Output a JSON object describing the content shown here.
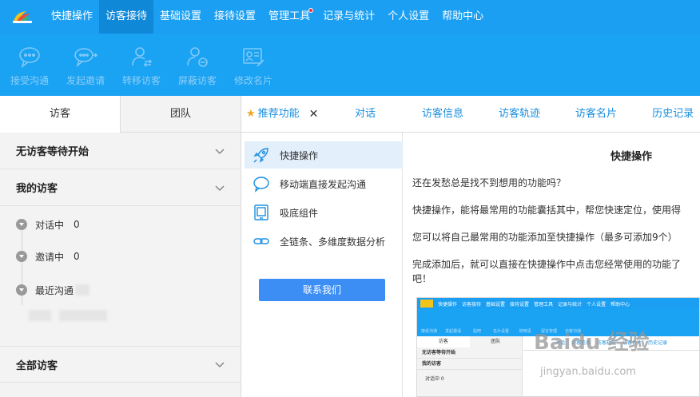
{
  "topnav": {
    "items": [
      {
        "label": "快捷操作"
      },
      {
        "label": "访客接待"
      },
      {
        "label": "基础设置"
      },
      {
        "label": "接待设置"
      },
      {
        "label": "管理工具"
      },
      {
        "label": "记录与统计"
      },
      {
        "label": "个人设置"
      },
      {
        "label": "帮助中心"
      }
    ],
    "active_index": 1,
    "notification_dot_index": 4
  },
  "toolbar": {
    "items": [
      {
        "label": "接受沟通",
        "icon": "chat-bubble-icon"
      },
      {
        "label": "发起邀请",
        "icon": "chat-send-icon"
      },
      {
        "label": "转移访客",
        "icon": "user-transfer-icon"
      },
      {
        "label": "屏蔽访客",
        "icon": "user-block-icon"
      },
      {
        "label": "修改名片",
        "icon": "card-edit-icon"
      }
    ]
  },
  "left": {
    "tabs": [
      {
        "label": "访客"
      },
      {
        "label": "团队"
      }
    ],
    "sections": {
      "waiting": "无访客等待开始",
      "my_visitors": "我的访客",
      "all_visitors": "全部访客"
    },
    "tree": [
      {
        "label": "对话中",
        "count": "0"
      },
      {
        "label": "邀请中",
        "count": "0"
      },
      {
        "label": "最近沟通",
        "count": ""
      }
    ]
  },
  "right": {
    "tabs": [
      {
        "label": "推荐功能"
      },
      {
        "label": "对话"
      },
      {
        "label": "访客信息"
      },
      {
        "label": "访客轨迹"
      },
      {
        "label": "访客名片"
      },
      {
        "label": "历史记录"
      }
    ],
    "close_glyph": "✕",
    "menu": [
      {
        "label": "快捷操作",
        "icon": "rocket-icon"
      },
      {
        "label": "移动端直接发起沟通",
        "icon": "chat-bubble-icon"
      },
      {
        "label": "吸底组件",
        "icon": "tablet-icon"
      },
      {
        "label": "全链条、多维度数据分析",
        "icon": "link-icon"
      }
    ],
    "contact_button": "联系我们",
    "content": {
      "title": "快捷操作",
      "p1": "还在发愁总是找不到想用的功能吗？",
      "p2": "快捷操作，能将最常用的功能囊括其中，帮您快速定位，使用得",
      "p3": "您可以将自己最常用的功能添加至快捷操作（最多可添加9个）",
      "p4a": "完成添加后，就可以直接在快捷操作中点击您经常使用的功能了",
      "p4b": "吧！"
    }
  },
  "mini": {
    "nav": [
      "快捷操作",
      "访客接待",
      "基础设置",
      "接待设置",
      "管理工具",
      "记录与统计",
      "个人设置",
      "帮助中心"
    ],
    "tools": [
      "接受沟通",
      "发起邀请",
      "贴吧",
      "名片设置",
      "常用语",
      "留言管理",
      "访客沟通"
    ],
    "ltabs": [
      "访客",
      "团队"
    ],
    "rows": [
      "无访客等待开始",
      "我的访客"
    ],
    "tree_item": "对话中 0",
    "rtabs": [
      "对话",
      "访客信息",
      "访客轨迹",
      "访客名片",
      "历史记录"
    ]
  },
  "watermark": {
    "text": "Baidu 经验",
    "sub": "jingyan.baidu.com"
  },
  "colors": {
    "primary": "#1a9ff2",
    "active_nav": "#0f88d8",
    "link": "#1a8fe0",
    "button": "#3c8ef5"
  }
}
